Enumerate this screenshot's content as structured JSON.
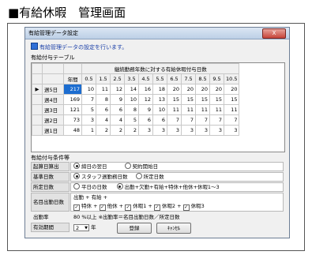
{
  "heading": "■有給休暇　管理画面",
  "window": {
    "title": "有給管理データ設定",
    "close_label": "X",
    "info": "有給管理データの設定を行います。"
  },
  "table_section": "有給付与テーブル",
  "grid": {
    "caption": "継続勤務年数に対する有給休暇付与日数",
    "year_label": "年間",
    "years": [
      "0.5",
      "1.5",
      "2.5",
      "3.5",
      "4.5",
      "5.5",
      "6.5",
      "7.5",
      "8.5",
      "9.5",
      "10.5"
    ],
    "rows": [
      {
        "label": "週5日",
        "marker": "▶",
        "days": "217",
        "values": [
          "10",
          "11",
          "12",
          "14",
          "16",
          "18",
          "20",
          "20",
          "20",
          "20",
          "20"
        ]
      },
      {
        "label": "週4日",
        "marker": "",
        "days": "169",
        "values": [
          "7",
          "8",
          "9",
          "10",
          "12",
          "13",
          "15",
          "15",
          "15",
          "15",
          "15"
        ]
      },
      {
        "label": "週3日",
        "marker": "",
        "days": "121",
        "values": [
          "5",
          "6",
          "6",
          "8",
          "9",
          "10",
          "11",
          "11",
          "11",
          "11",
          "11"
        ]
      },
      {
        "label": "週2日",
        "marker": "",
        "days": "73",
        "values": [
          "3",
          "4",
          "4",
          "5",
          "6",
          "6",
          "7",
          "7",
          "7",
          "7",
          "7"
        ]
      },
      {
        "label": "週1日",
        "marker": "",
        "days": "48",
        "values": [
          "1",
          "2",
          "2",
          "2",
          "3",
          "3",
          "3",
          "3",
          "3",
          "3",
          "3"
        ]
      }
    ]
  },
  "conditions_section": "有給付与条件等",
  "conditions": {
    "start": {
      "label": "起算日算出",
      "opt1": "締日の翌日",
      "opt2": "契約開始日"
    },
    "base": {
      "label": "基準日数",
      "opt1": "スタッフ週勤務日数",
      "opt2": "所定日数"
    },
    "prescribed": {
      "label": "所定日数",
      "opt1": "平日の日数",
      "opt2": "出勤+欠勤+有給+特休+他休+休暇1〜3"
    },
    "attend": {
      "label": "名目出勤日数",
      "line1": "出勤 + 有給 +",
      "c1": "特休",
      "c2": "他休",
      "c3": "休暇1",
      "c4": "休暇2",
      "c5": "休暇3"
    },
    "rate": {
      "label": "出勤率",
      "value": "80",
      "note": "%以上 ※出勤率＝名目出勤日数／所定日数"
    },
    "valid": {
      "label": "有効期間",
      "value": "2",
      "unit": "年"
    }
  },
  "buttons": {
    "save": "登録",
    "cancel": "ｷｬﾝｾﾙ"
  }
}
